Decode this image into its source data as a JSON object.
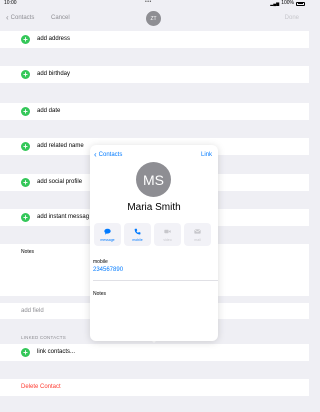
{
  "status": {
    "time": "10:00",
    "dots": "•••",
    "battery": "100%"
  },
  "nav": {
    "back_label": "Contacts",
    "cancel_label": "Cancel",
    "avatar_initials": "ZT",
    "done_label": "Done"
  },
  "form": {
    "add_rows": [
      {
        "label": "add address"
      },
      {
        "label": "add birthday"
      },
      {
        "label": "add date"
      },
      {
        "label": "add related name"
      },
      {
        "label": "add social profile"
      },
      {
        "label": "add instant messag"
      }
    ],
    "notes_label": "Notes",
    "add_field_label": "add field",
    "linked_header": "LINKED CONTACTS",
    "link_contacts_label": "link contacts...",
    "delete_label": "Delete Contact"
  },
  "popover": {
    "back_label": "Contacts",
    "link_label": "Link",
    "avatar_initials": "MS",
    "name": "Maria Smith",
    "actions": [
      {
        "label": "message",
        "icon": "message-icon",
        "enabled": true
      },
      {
        "label": "mobile",
        "icon": "phone-icon",
        "enabled": true
      },
      {
        "label": "video",
        "icon": "video-icon",
        "enabled": false
      },
      {
        "label": "mail",
        "icon": "mail-icon",
        "enabled": false
      }
    ],
    "phone_label": "mobile",
    "phone_value": "234567890",
    "notes_label": "Notes"
  },
  "colors": {
    "accent": "#007aff",
    "add_green": "#34c759",
    "delete_red": "#ff3b30",
    "background": "#efeff4"
  }
}
